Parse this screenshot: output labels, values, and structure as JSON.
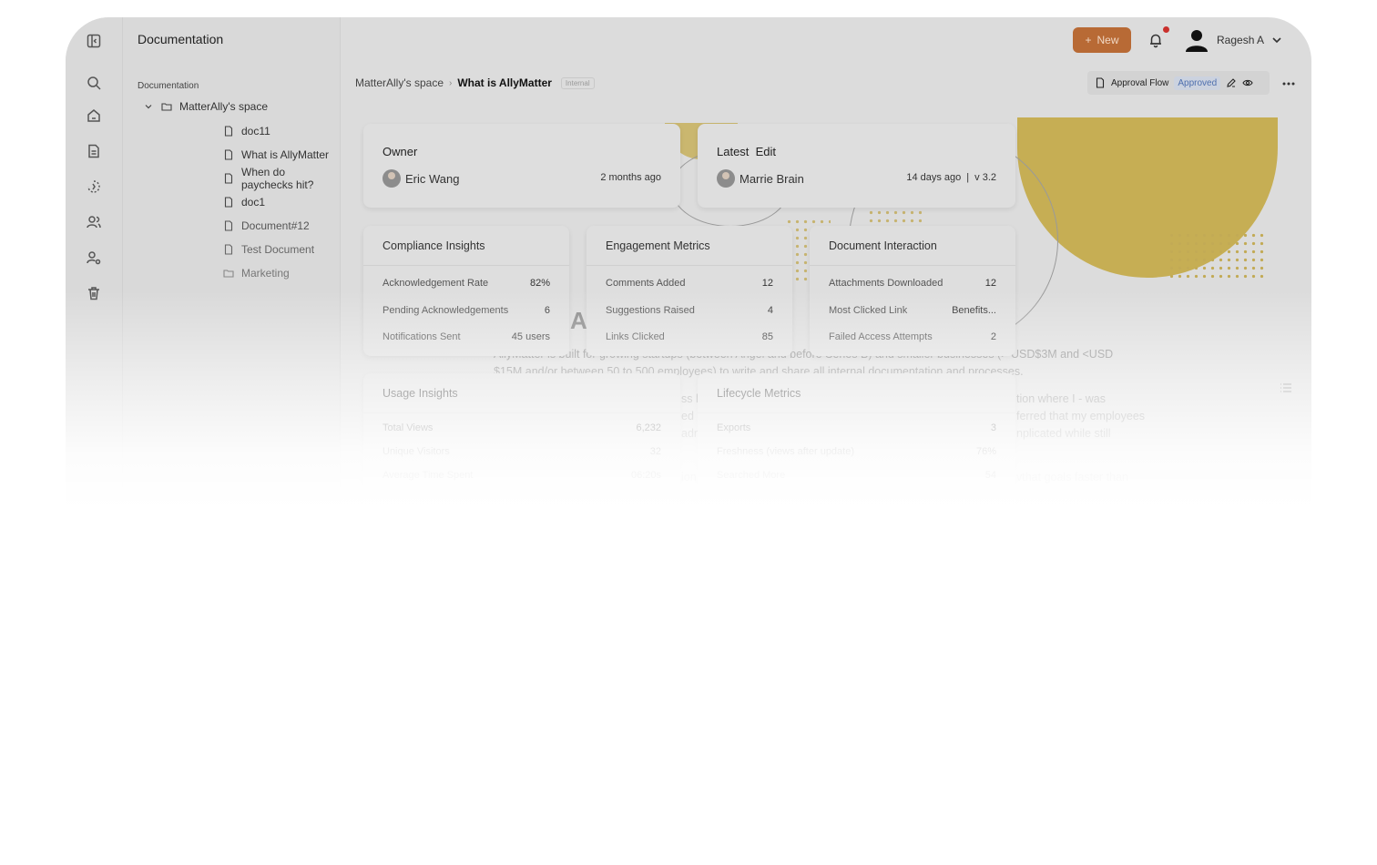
{
  "sidebar": {
    "title": "Documentation",
    "section_label": "Documentation",
    "space": "MatterAlly's space",
    "items": [
      {
        "label": "doc11"
      },
      {
        "label": "What is AllyMatter"
      },
      {
        "label": "When do paychecks hit?"
      },
      {
        "label": "doc1"
      },
      {
        "label": "Document#12"
      },
      {
        "label": "Test Document"
      },
      {
        "label": "Marketing"
      }
    ]
  },
  "topbar": {
    "new_label": "New",
    "user_name": "Ragesh A"
  },
  "breadcrumb": {
    "space": "MatterAlly's space",
    "current": "What is AllyMatter",
    "tag": "Internal"
  },
  "approval": {
    "label": "Approval Flow",
    "status": "Approved"
  },
  "owner_card": {
    "title": "Owner",
    "name": "Eric Wang",
    "time": "2 months ago"
  },
  "edit_card": {
    "title": "Latest  Edit",
    "name": "Marrie Brain",
    "time": "14 days ago",
    "version": "v 3.2"
  },
  "compliance": {
    "title": "Compliance Insights",
    "rows": [
      {
        "label": "Acknowledgement Rate",
        "value": "82%"
      },
      {
        "label": "Pending Acknowledgements",
        "value": "6"
      },
      {
        "label": "Notifications Sent",
        "value": "45 users"
      }
    ]
  },
  "engagement": {
    "title": "Engagement Metrics",
    "rows": [
      {
        "label": "Comments Added",
        "value": "12"
      },
      {
        "label": "Suggestions Raised",
        "value": "4"
      },
      {
        "label": "Links Clicked",
        "value": "85"
      }
    ]
  },
  "interaction": {
    "title": "Document Interaction",
    "rows": [
      {
        "label": "Attachments Downloaded",
        "value": "12"
      },
      {
        "label": "Most Clicked Link",
        "value": "Benefits..."
      },
      {
        "label": "Failed Access Attempts",
        "value": "2"
      }
    ]
  },
  "usage": {
    "title": "Usage Insights",
    "rows": [
      {
        "label": "Total Views",
        "value": "6,232"
      },
      {
        "label": "Unique Visitors",
        "value": "32"
      },
      {
        "label": "Average Time Spent",
        "value": "06:20s"
      }
    ]
  },
  "lifecycle": {
    "title": "Lifecycle Metrics",
    "rows": [
      {
        "label": "Exports",
        "value": "3"
      },
      {
        "label": "Freshness (views after update)",
        "value": "76%"
      },
      {
        "label": "Searched More",
        "value": "54"
      }
    ]
  },
  "doc": {
    "heading_fragment": "A",
    "lines": [
      "AllyMatter is built for growing startups (between Angel and before Series B) and smaller businesses (> USD$3M and <USD",
      "$15M and/or between 50 to 500 employees) to write and share all internal documentation and processes.",
      "ss l",
      "tion where I - was",
      "ed",
      "ferred that my employees",
      "adn",
      "nplicated while still",
      "ion",
      "vthat goals faster than"
    ]
  }
}
